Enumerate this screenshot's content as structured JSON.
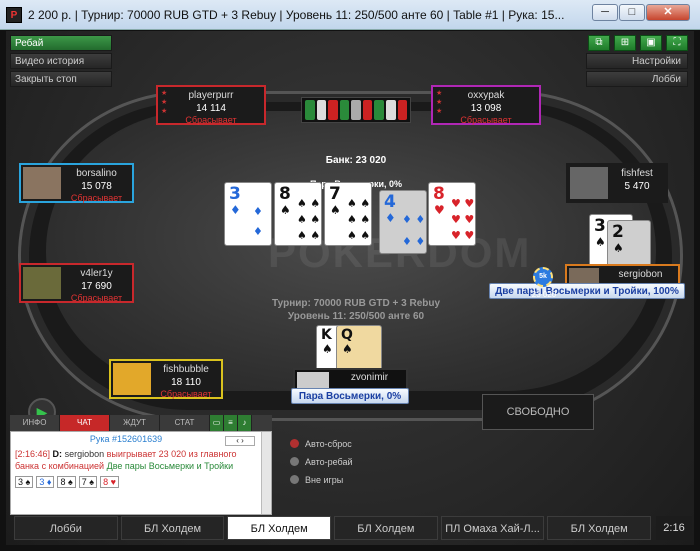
{
  "window": {
    "title": "2 200 р. | Турнир: 70000 RUB GTD + 3 Rebuy | Уровень 11: 250/500 анте 60 | Table #1 | Рука: 15...",
    "minimize": "─",
    "maximize": "□",
    "close": "✕",
    "logo": "P"
  },
  "left_menu": {
    "rebuy": "Ребай",
    "video": "Видео история",
    "close_stop": "Закрыть стоп"
  },
  "right_menu": {
    "settings": "Настройки",
    "lobby": "Лобби"
  },
  "table": {
    "bank": "Банк: 23 020",
    "combo": "Пара Восьмерки, 0%",
    "watermark": "POKERDOM",
    "info_line1": "Турнир: 70000 RUB GTD + 3 Rebuy",
    "info_line2": "Уровень 11: 250/500 анте 60",
    "pot_chip": "5k",
    "pot_value": "23 020",
    "free_seat": "СВОБОДНО"
  },
  "board": [
    {
      "rank": "3",
      "suit": "♦",
      "color": "blue"
    },
    {
      "rank": "8",
      "suit": "♠",
      "color": "blk"
    },
    {
      "rank": "7",
      "suit": "♠",
      "color": "blk"
    },
    {
      "rank": "4",
      "suit": "♦",
      "color": "blue"
    },
    {
      "rank": "8",
      "suit": "♥",
      "color": "red"
    }
  ],
  "hero_cards": [
    {
      "rank": "K",
      "suit": "♠"
    },
    {
      "rank": "Q",
      "suit": "♠"
    }
  ],
  "winner_cards": [
    {
      "rank": "3",
      "suit": "♠"
    },
    {
      "rank": "2",
      "suit": "♠"
    }
  ],
  "seats": {
    "playerpurr": {
      "name": "playerpurr",
      "stack": "14 114",
      "action": "Сбрасывает",
      "border": "#c8282c"
    },
    "oxxypak": {
      "name": "oxxypak",
      "stack": "13 098",
      "action": "Сбрасывает",
      "border": "#b027b5"
    },
    "borsalino": {
      "name": "borsalino",
      "stack": "15 078",
      "action": "Сбрасывает",
      "border": "#2aa4dd"
    },
    "fishfest": {
      "name": "fishfest",
      "stack": "5 470",
      "border": "#1b1b1b"
    },
    "v4ler1y": {
      "name": "v4ler1y",
      "stack": "17 690",
      "action": "Сбрасывает",
      "border": "#c8282c"
    },
    "sergiobon": {
      "name": "sergiobon",
      "border": "#d97a1e"
    },
    "fishbubble": {
      "name": "fishbubble",
      "stack": "18 110",
      "action": "Сбрасывает",
      "border": "#d9c21e"
    },
    "zvonimir": {
      "name": "zvonimir"
    }
  },
  "badges": {
    "winner": "Две пары Восьмерки и Тройки, 100%",
    "hero": "Пара Восьмерки, 0%"
  },
  "chat": {
    "tabs": [
      "ИНФО",
      "ЧАТ",
      "ЖДУТ",
      "СТАТ"
    ],
    "hand": "Рука #152601639",
    "time": "[2:16:46]",
    "player": "sergiobon",
    "text1": "выигрывает 23 020 из главного",
    "text2": "банка с комбинацией",
    "combo": "Две пары Восьмерки и Тройки",
    "cards": [
      {
        "r": "3",
        "s": "♠",
        "c": "blk"
      },
      {
        "r": "3",
        "s": "♦",
        "c": "blue"
      },
      {
        "r": "8",
        "s": "♠",
        "c": "blk"
      },
      {
        "r": "7",
        "s": "♠",
        "c": "blk"
      },
      {
        "r": "8",
        "s": "♥",
        "c": "red"
      }
    ]
  },
  "options": {
    "autofold": "Авто-сброс",
    "autorebuy": "Авто-ребай",
    "sitout": "Вне игры"
  },
  "tabs": [
    "Лобби",
    "БЛ Холдем",
    "БЛ Холдем",
    "БЛ Холдем",
    "ПЛ Омаха Хай-Л...",
    "БЛ Холдем"
  ],
  "clock": "2:16"
}
